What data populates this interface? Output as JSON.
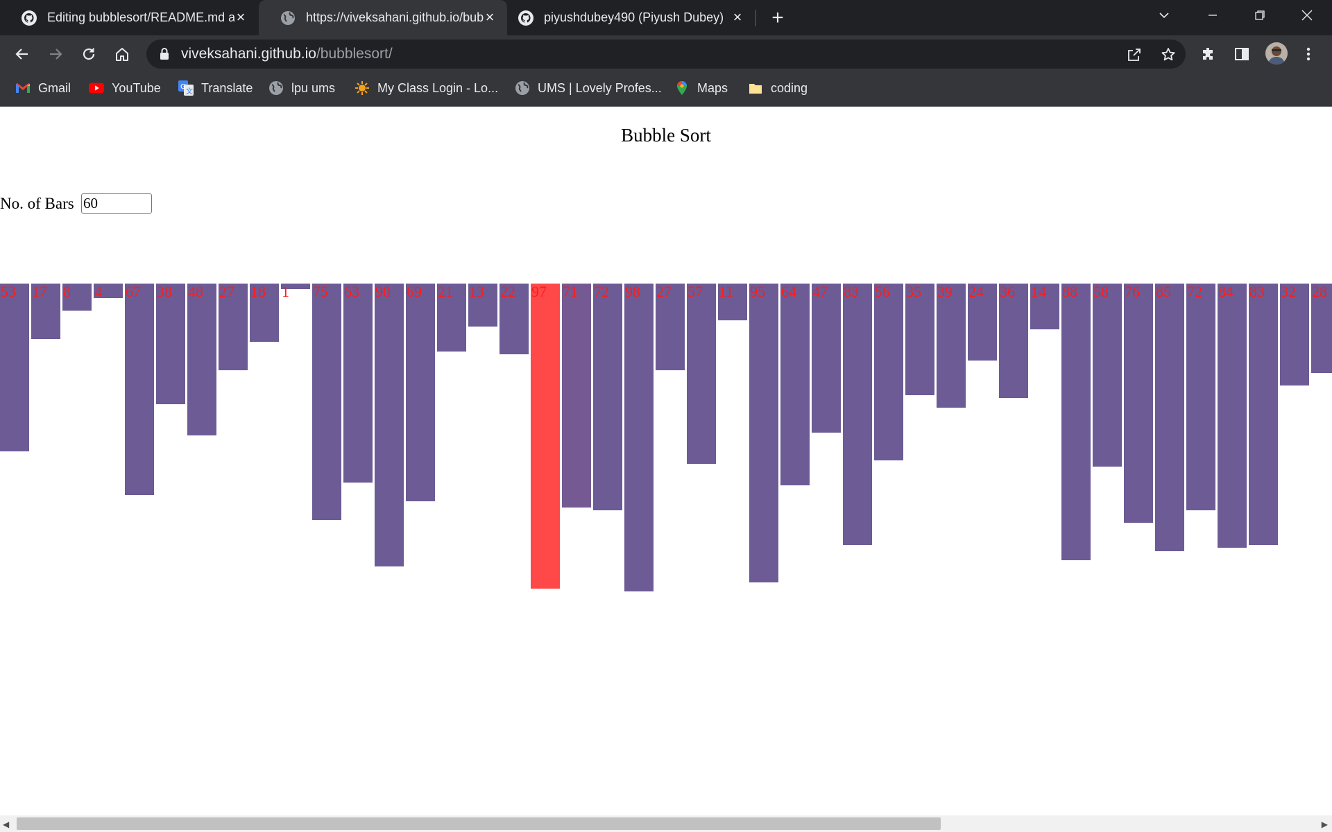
{
  "browser": {
    "tabs": [
      {
        "title": "Editing bubblesort/README.md a",
        "icon": "github-icon",
        "active": false
      },
      {
        "title": "https://viveksahani.github.io/bub",
        "icon": "globe-icon",
        "active": true
      },
      {
        "title": "piyushdubey490 (Piyush Dubey)",
        "icon": "github-icon",
        "active": false
      }
    ],
    "url_host": "viveksahani.github.io",
    "url_path": "/bubblesort/",
    "bookmarks": [
      {
        "label": "Gmail",
        "icon": "gmail-icon"
      },
      {
        "label": "YouTube",
        "icon": "youtube-icon"
      },
      {
        "label": "Translate",
        "icon": "translate-icon"
      },
      {
        "label": "lpu ums",
        "icon": "globe-icon"
      },
      {
        "label": "My Class Login - Lo...",
        "icon": "sun-icon"
      },
      {
        "label": "UMS | Lovely Profes...",
        "icon": "globe-icon"
      },
      {
        "label": "Maps",
        "icon": "maps-icon"
      },
      {
        "label": "coding",
        "icon": "folder-icon"
      }
    ]
  },
  "page": {
    "heading": "Bubble Sort",
    "bars_label": "No. of Bars",
    "bars_value": "60"
  },
  "chart_data": {
    "type": "bar",
    "values": [
      53,
      17,
      8,
      4,
      67,
      38,
      48,
      27,
      18,
      1,
      75,
      63,
      90,
      69,
      21,
      13,
      22,
      97,
      71,
      72,
      98,
      27,
      57,
      11,
      95,
      64,
      47,
      83,
      56,
      35,
      39,
      24,
      36,
      14,
      88,
      58,
      76,
      85,
      72,
      84,
      83,
      32,
      28
    ],
    "active_index": 17,
    "compare_index": 18,
    "colors": {
      "bar": "#6c5b95",
      "active": "#ff4848",
      "label": "#ff1c1c"
    }
  },
  "scrollbar": {
    "position": 0
  }
}
